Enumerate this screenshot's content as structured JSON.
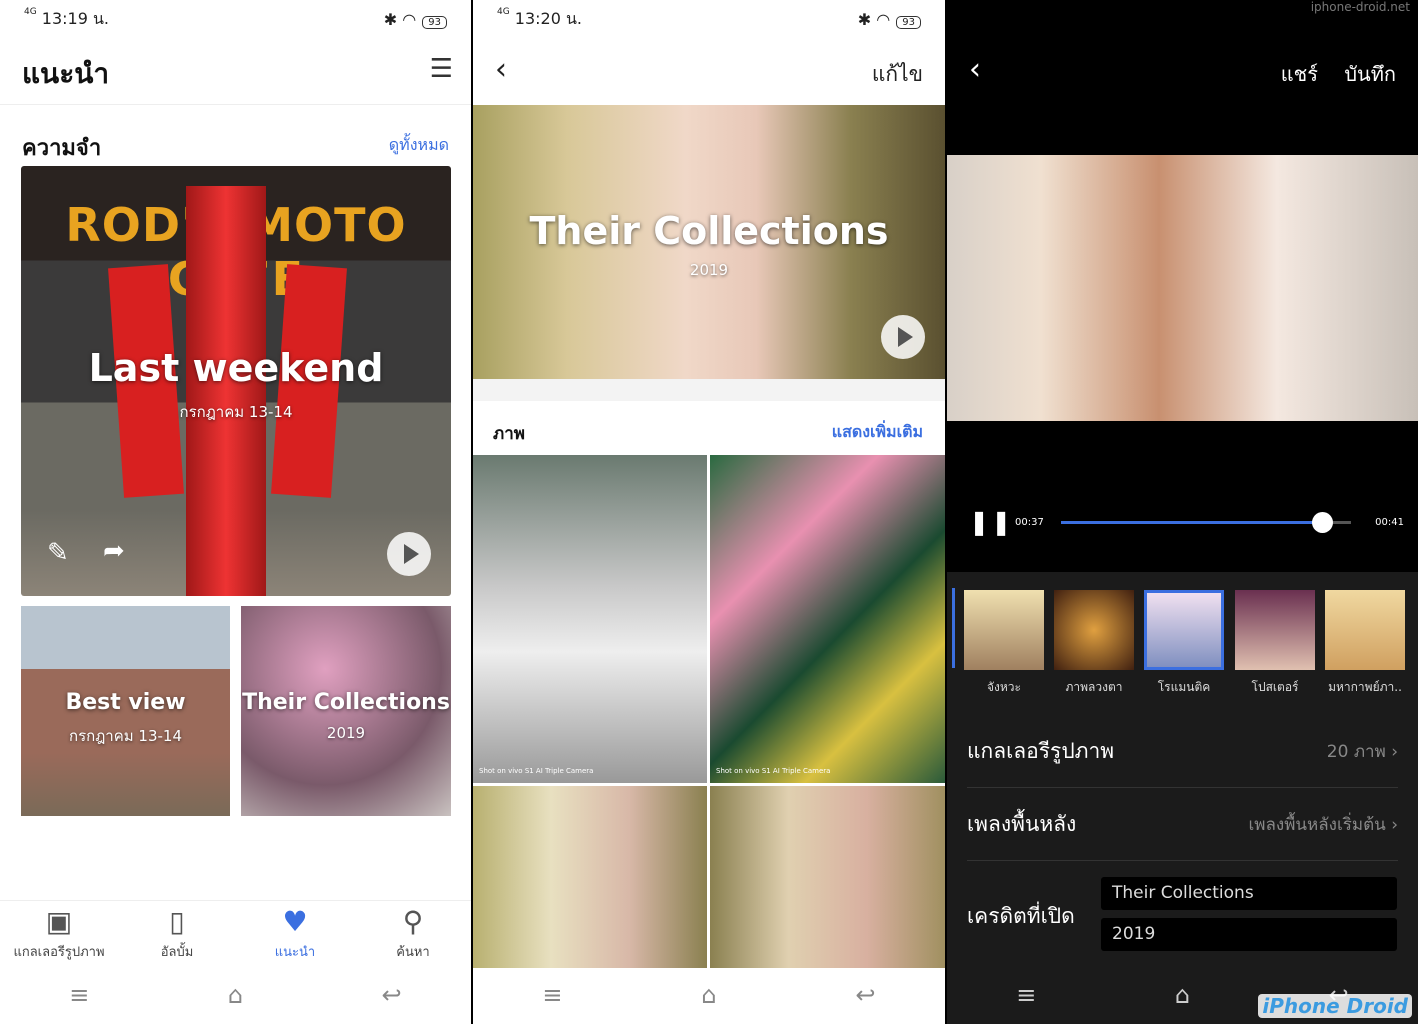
{
  "screen1": {
    "status": {
      "time": "13:19 น.",
      "network": "4G",
      "battery": "93"
    },
    "title": "แนะนำ",
    "menu_icon": "list-icon",
    "section": {
      "title": "ความจำ",
      "see_all": "ดูทั้งหมด"
    },
    "main_card": {
      "title": "Last weekend",
      "date": "กรกฎาคม 13-14",
      "sign_text": "ROD'S MOTO CAFE"
    },
    "cards": [
      {
        "title": "Best view",
        "date": "กรกฎาคม 13-14"
      },
      {
        "title": "Their Collections",
        "date": "2019"
      }
    ],
    "bottom_nav": [
      {
        "label": "แกลเลอรีรูปภาพ",
        "icon": "gallery-icon"
      },
      {
        "label": "อัลบั้ม",
        "icon": "album-icon"
      },
      {
        "label": "แนะนำ",
        "icon": "recommend-heart-icon",
        "active": true
      },
      {
        "label": "ค้นหา",
        "icon": "search-icon"
      }
    ],
    "accent": "#3b6fe0"
  },
  "screen2": {
    "status": {
      "time": "13:20 น.",
      "network": "4G",
      "battery": "93"
    },
    "edit": "แก้ไข",
    "hero": {
      "title": "Their Collections",
      "year": "2019"
    },
    "photos_section": {
      "title": "ภาพ",
      "more": "แสดงเพิ่มเติม"
    },
    "watermark": "Shot on vivo S1 AI Triple Camera"
  },
  "screen3": {
    "share": "แชร์",
    "save": "บันทึก",
    "player": {
      "current": "00:37",
      "total": "00:41",
      "progress": 0.9
    },
    "themes": [
      "จังหวะ",
      "ภาพลวงตา",
      "โรแมนติค",
      "โปสเตอร์",
      "มหากาพย์ภา.."
    ],
    "selected_theme": "โรแมนติค",
    "rows": [
      {
        "label": "แกลเลอรีรูปภาพ",
        "value": "20 ภาพ"
      },
      {
        "label": "เพลงพื้นหลัง",
        "value": "เพลงพื้นหลังเริ่มต้น"
      }
    ],
    "credits": {
      "label": "เครดิตที่เปิด",
      "title": "Their Collections",
      "year": "2019"
    },
    "site_watermark": "iphone-droid.net",
    "logo": "iPhone Droid"
  }
}
